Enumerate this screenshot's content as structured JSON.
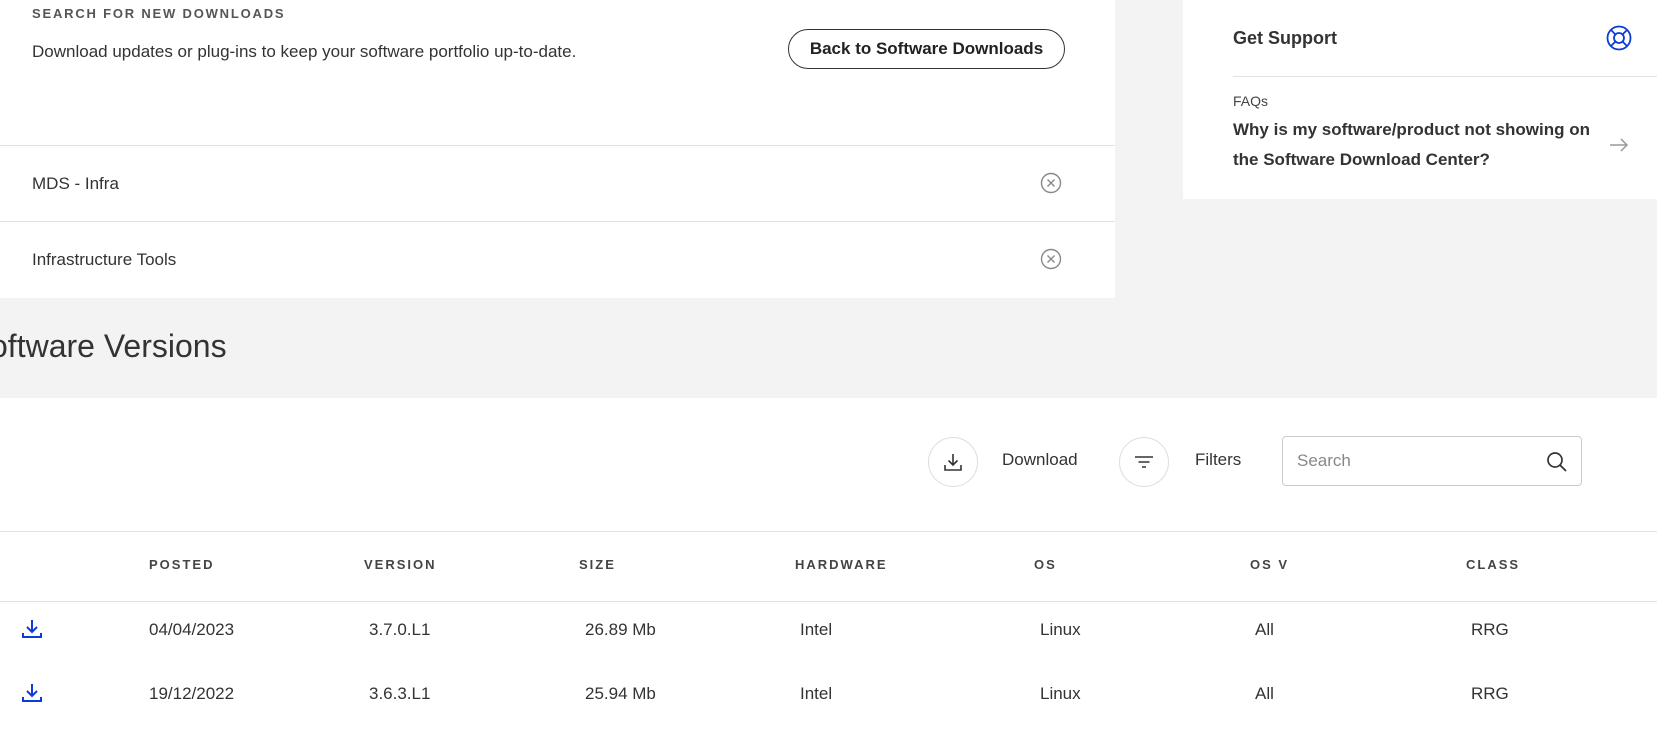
{
  "search_section": {
    "eyebrow": "SEARCH FOR NEW DOWNLOADS",
    "description": "Download updates or plug-ins to keep your software portfolio up-to-date.",
    "back_button": "Back to Software Downloads"
  },
  "active_filters": [
    {
      "label": "MDS - Infra",
      "clear_icon": "close-circle-icon"
    },
    {
      "label": "Infrastructure Tools",
      "clear_icon": "close-circle-icon"
    }
  ],
  "support": {
    "title": "Get Support",
    "icon": "lifebuoy-icon",
    "faq_label": "FAQs",
    "faq_question": "Why is my software/product not showing on the Software Download Center?",
    "arrow_icon": "arrow-right-icon"
  },
  "versions": {
    "title": "oftware Versions",
    "toolbar": {
      "download_label": "Download",
      "filters_label": "Filters",
      "search_placeholder": "Search"
    },
    "columns": [
      "POSTED",
      "VERSION",
      "SIZE",
      "HARDWARE",
      "OS",
      "OS V",
      "CLASS"
    ],
    "rows": [
      {
        "posted": "04/04/2023",
        "version": "3.7.0.L1",
        "size": "26.89 Mb",
        "hardware": "Intel",
        "os": "Linux",
        "os_v": "All",
        "class": "RRG"
      },
      {
        "posted": "19/12/2022",
        "version": "3.6.3.L1",
        "size": "25.94 Mb",
        "hardware": "Intel",
        "os": "Linux",
        "os_v": "All",
        "class": "RRG"
      }
    ]
  },
  "colors": {
    "accent": "#0e3bd6",
    "page_bg": "#f3f3f3"
  }
}
